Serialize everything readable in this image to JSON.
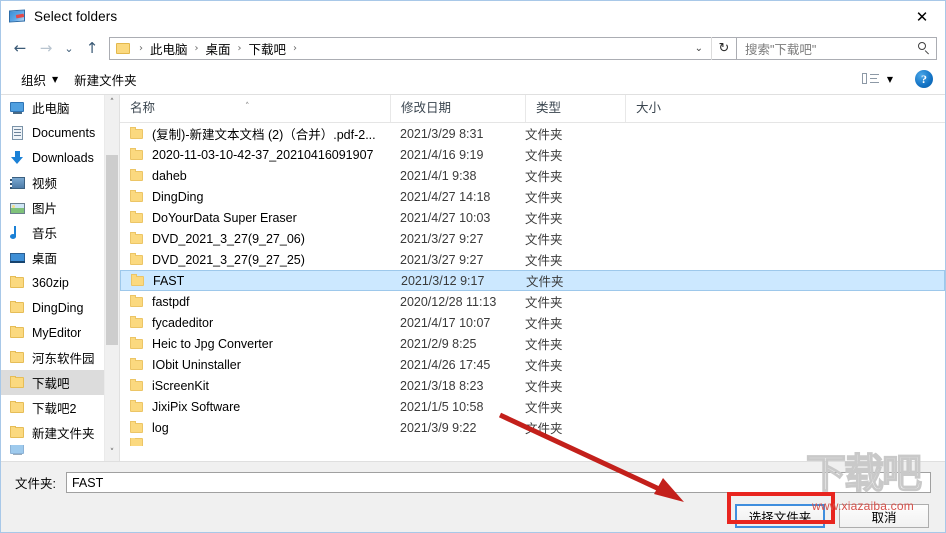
{
  "window": {
    "title": "Select folders",
    "icon": "app-screenshot-icon",
    "close_label": "✕"
  },
  "nav": {
    "back": "←",
    "forward": "→",
    "recent": "⌄",
    "up": "↑",
    "breadcrumbs": [
      "此电脑",
      "桌面",
      "下载吧"
    ],
    "separator": "›",
    "dropdown": "⌄",
    "refresh": "↻"
  },
  "search": {
    "placeholder": "搜索\"下载吧\"",
    "icon": "search-icon"
  },
  "toolbar": {
    "organize": "组织",
    "organize_caret": "▼",
    "new_folder": "新建文件夹",
    "view_caret": "▼",
    "help": "?"
  },
  "sidebar": {
    "items": [
      {
        "label": "此电脑",
        "icon": "computer-icon",
        "selected": false
      },
      {
        "label": "Documents",
        "icon": "documents-icon",
        "selected": false
      },
      {
        "label": "Downloads",
        "icon": "downloads-icon",
        "selected": false
      },
      {
        "label": "视频",
        "icon": "videos-icon",
        "selected": false
      },
      {
        "label": "图片",
        "icon": "pictures-icon",
        "selected": false
      },
      {
        "label": "音乐",
        "icon": "music-icon",
        "selected": false
      },
      {
        "label": "桌面",
        "icon": "desktop-icon",
        "selected": false
      },
      {
        "label": "360zip",
        "icon": "folder-icon",
        "selected": false
      },
      {
        "label": "DingDing",
        "icon": "folder-icon",
        "selected": false
      },
      {
        "label": "MyEditor",
        "icon": "folder-icon",
        "selected": false
      },
      {
        "label": "河东软件园",
        "icon": "folder-icon",
        "selected": false
      },
      {
        "label": "下载吧",
        "icon": "folder-icon",
        "selected": true
      },
      {
        "label": "下载吧2",
        "icon": "folder-icon",
        "selected": false
      },
      {
        "label": "新建文件夹",
        "icon": "folder-icon",
        "selected": false
      }
    ],
    "scroll_up": "˄",
    "scroll_down": "˅"
  },
  "filelist": {
    "columns": [
      "名称",
      "修改日期",
      "类型",
      "大小"
    ],
    "sort_caret": "˄",
    "rows": [
      {
        "name": "(复制)-新建文本文档 (2)（合并）.pdf-2...",
        "date": "2021/3/29 8:31",
        "type": "文件夹",
        "size": "",
        "selected": false
      },
      {
        "name": "2020-11-03-10-42-37_20210416091907",
        "date": "2021/4/16 9:19",
        "type": "文件夹",
        "size": "",
        "selected": false
      },
      {
        "name": "daheb",
        "date": "2021/4/1 9:38",
        "type": "文件夹",
        "size": "",
        "selected": false
      },
      {
        "name": "DingDing",
        "date": "2021/4/27 14:18",
        "type": "文件夹",
        "size": "",
        "selected": false
      },
      {
        "name": "DoYourData Super Eraser",
        "date": "2021/4/27 10:03",
        "type": "文件夹",
        "size": "",
        "selected": false
      },
      {
        "name": "DVD_2021_3_27(9_27_06)",
        "date": "2021/3/27 9:27",
        "type": "文件夹",
        "size": "",
        "selected": false
      },
      {
        "name": "DVD_2021_3_27(9_27_25)",
        "date": "2021/3/27 9:27",
        "type": "文件夹",
        "size": "",
        "selected": false
      },
      {
        "name": "FAST",
        "date": "2021/3/12 9:17",
        "type": "文件夹",
        "size": "",
        "selected": true
      },
      {
        "name": "fastpdf",
        "date": "2020/12/28 11:13",
        "type": "文件夹",
        "size": "",
        "selected": false
      },
      {
        "name": "fycadeditor",
        "date": "2021/4/17 10:07",
        "type": "文件夹",
        "size": "",
        "selected": false
      },
      {
        "name": "Heic to Jpg Converter",
        "date": "2021/2/9 8:25",
        "type": "文件夹",
        "size": "",
        "selected": false
      },
      {
        "name": "IObit Uninstaller",
        "date": "2021/4/26 17:45",
        "type": "文件夹",
        "size": "",
        "selected": false
      },
      {
        "name": "iScreenKit",
        "date": "2021/3/18 8:23",
        "type": "文件夹",
        "size": "",
        "selected": false
      },
      {
        "name": "JixiPix Software",
        "date": "2021/1/5 10:58",
        "type": "文件夹",
        "size": "",
        "selected": false
      },
      {
        "name": "log",
        "date": "2021/3/9 9:22",
        "type": "文件夹",
        "size": "",
        "selected": false
      }
    ]
  },
  "footer": {
    "folder_label": "文件夹:",
    "folder_value": "FAST",
    "select_button": "选择文件夹",
    "cancel_button": "取消"
  },
  "watermark": {
    "big": "下载吧",
    "small": "www.xiazaiba.com"
  },
  "colors": {
    "selection": "#cce8ff",
    "annotation": "#e8251f",
    "focus": "#3f8ede",
    "accent": "#1272c4"
  }
}
